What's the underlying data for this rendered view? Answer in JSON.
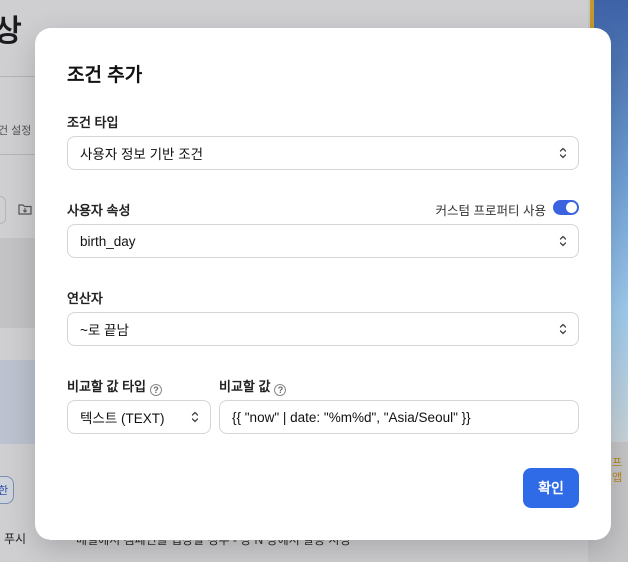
{
  "background": {
    "title_fragment": "상",
    "small_text": "건 설정",
    "push_label": "푸시",
    "bottom_text": "메일에서 캠페인을 입장할 경우 - 장 N 장에서 발송 시정",
    "right_text_line1": "프",
    "right_text_line2": "앱",
    "bubble_text": "한"
  },
  "modal": {
    "title": "조건 추가",
    "condition_type": {
      "label": "조건 타입",
      "value": "사용자 정보 기반 조건"
    },
    "user_attribute": {
      "label": "사용자 속성",
      "custom_toggle_label": "커스텀 프로퍼티 사용",
      "custom_toggle_on": true,
      "value": "birth_day"
    },
    "operator": {
      "label": "연산자",
      "value": "~로 끝남"
    },
    "compare_type": {
      "label": "비교할 값 타입",
      "value": "텍스트 (TEXT)"
    },
    "compare_value": {
      "label": "비교할 값",
      "value": "{{ \"now\" | date: \"%m%d\", \"Asia/Seoul\" }}"
    },
    "confirm_label": "확인"
  },
  "icons": {
    "help": "question-circle-icon",
    "select": "chevron-up-down-icon",
    "folder": "folder-download-icon"
  },
  "colors": {
    "accent": "#2f6be6",
    "toggle": "#3b63e0"
  }
}
